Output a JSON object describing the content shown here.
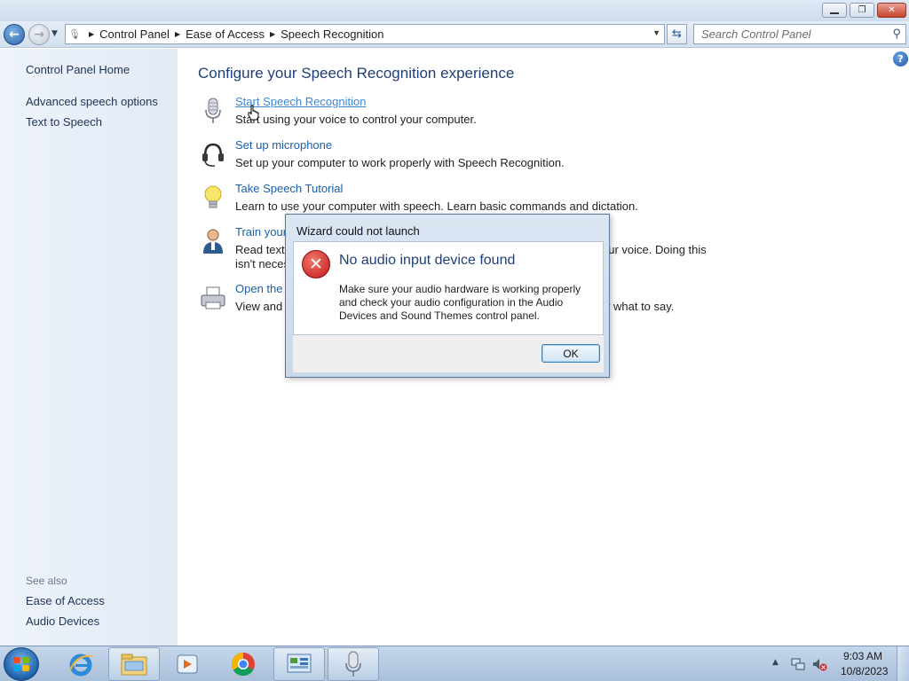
{
  "address_bar": {
    "crumbs": [
      "Control Panel",
      "Ease of Access",
      "Speech Recognition"
    ]
  },
  "search": {
    "placeholder": "Search Control Panel"
  },
  "sidebar": {
    "items": [
      {
        "label": "Control Panel Home"
      },
      {
        "label": "Advanced speech options"
      },
      {
        "label": "Text to Speech"
      }
    ],
    "see_also_heading": "See also",
    "see_also": [
      {
        "label": "Ease of Access"
      },
      {
        "label": "Audio Devices"
      }
    ]
  },
  "main": {
    "title": "Configure your Speech Recognition experience",
    "tasks": [
      {
        "label": "Start Speech Recognition",
        "desc": "Start using your voice to control your computer.",
        "desc2": "",
        "icon": "microphone-icon"
      },
      {
        "label": "Set up microphone",
        "desc": "Set up your computer to work properly with Speech Recognition.",
        "desc2": "",
        "icon": "headset-icon"
      },
      {
        "label": "Take Speech Tutorial",
        "desc": "Learn to use your computer with speech.  Learn basic commands and dictation.",
        "desc2": "",
        "icon": "lightbulb-icon"
      },
      {
        "label": "Train your",
        "desc": "Read text t",
        "desc_right": "our voice.  Doing this",
        "desc2": "isn't neces",
        "icon": "person-icon"
      },
      {
        "label": "Open the S",
        "desc": "View and p",
        "desc_right": "w what to say.",
        "desc2": "",
        "icon": "printer-icon"
      }
    ]
  },
  "dialog": {
    "title": "Wizard could not launch",
    "heading": "No audio input device found",
    "message": "Make sure your audio hardware is working properly and check your audio configuration in the Audio Devices and Sound Themes control panel.",
    "ok_label": "OK",
    "icon": "error-icon"
  },
  "taskbar": {
    "items": [
      "internet-explorer-icon",
      "file-explorer-icon",
      "media-player-icon",
      "chrome-icon",
      "control-panel-icon",
      "speech-recognition-icon"
    ],
    "time": "9:03 AM",
    "date": "10/8/2023"
  },
  "colors": {
    "link": "#1a5fa8",
    "title": "#1e3f78",
    "error": "#c4141a"
  }
}
